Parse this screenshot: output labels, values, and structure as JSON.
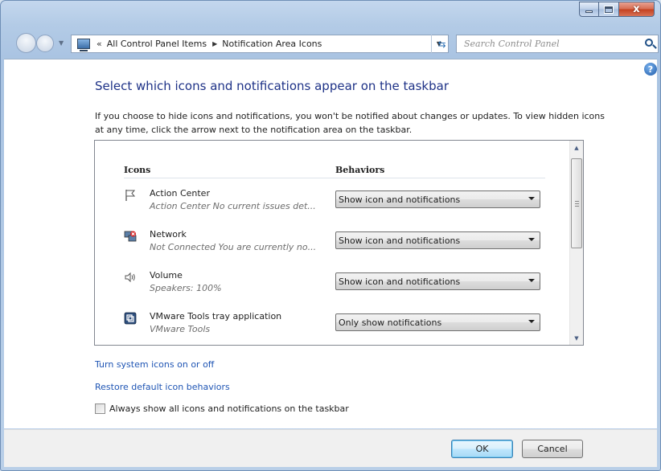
{
  "window": {
    "caption": {
      "minimize": "",
      "maximize": "",
      "close": "x"
    }
  },
  "navigation": {
    "address_chevron": "«",
    "breadcrumbs": [
      "All Control Panel Items",
      "Notification Area Icons"
    ],
    "search_placeholder": "Search Control Panel"
  },
  "main": {
    "title": "Select which icons and notifications appear on the taskbar",
    "description": "If you choose to hide icons and notifications, you won't be notified about changes or updates. To view hidden icons at any time, click the arrow next to the notification area on the taskbar.",
    "columns": {
      "icons": "Icons",
      "behaviors": "Behaviors"
    },
    "items": [
      {
        "icon": "flag-icon",
        "name": "Action Center",
        "subtitle": "Action Center  No current issues det...",
        "behavior": "Show icon and notifications"
      },
      {
        "icon": "network-icon",
        "name": "Network",
        "subtitle": "Not Connected You are currently no...",
        "behavior": "Show icon and notifications"
      },
      {
        "icon": "speaker-icon",
        "name": "Volume",
        "subtitle": "Speakers: 100%",
        "behavior": "Show icon and notifications"
      },
      {
        "icon": "vmware-icon",
        "name": "VMware Tools tray application",
        "subtitle": "VMware Tools",
        "behavior": "Only show notifications"
      }
    ],
    "links": {
      "system_icons": "Turn system icons on or off",
      "restore_defaults": "Restore default icon behaviors"
    },
    "always_show": {
      "label": "Always show all icons and notifications on the taskbar",
      "checked": false
    }
  },
  "footer": {
    "ok_label": "OK",
    "cancel_label": "Cancel"
  },
  "help": {
    "glyph": "?"
  }
}
